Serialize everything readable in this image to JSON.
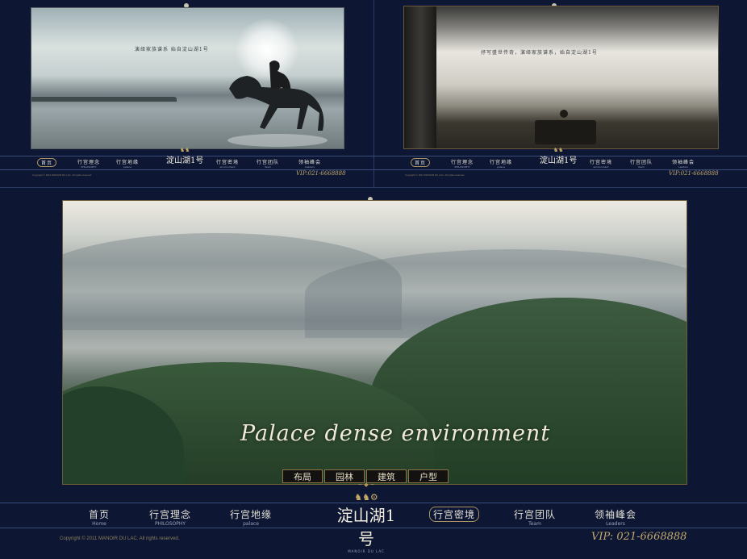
{
  "top_left": {
    "slogan": "演绎家族谱系  始自淀山湖1号",
    "nav": [
      {
        "cn": "首页",
        "en": "Home",
        "active": true
      },
      {
        "cn": "行宫理念",
        "en": "PHILOSOPHY"
      },
      {
        "cn": "行宫地缘",
        "en": "palace"
      },
      {
        "cn": "行宫密境",
        "en": "environment"
      },
      {
        "cn": "行宫团队",
        "en": "Team"
      },
      {
        "cn": "领袖峰会",
        "en": "Leaders"
      }
    ],
    "logo": "淀山湖1号",
    "vip": "VIP:021-6668888",
    "copyright": "Copyright © 2011 MANOIR DU LAC. All rights reserved"
  },
  "top_right": {
    "slogan": "抒写盛世传奇，演绎家族谱系，始自淀山湖1号",
    "nav": [
      {
        "cn": "首页",
        "en": "Home",
        "active": true
      },
      {
        "cn": "行宫理念",
        "en": "PHILOSOPHY"
      },
      {
        "cn": "行宫地缘",
        "en": "palace"
      },
      {
        "cn": "行宫密境",
        "en": "environment"
      },
      {
        "cn": "行宫团队",
        "en": "Team"
      },
      {
        "cn": "领袖峰会",
        "en": "Leaders"
      }
    ],
    "logo": "淀山湖1号",
    "vip": "VIP:021-6668888",
    "copyright": "Copyright © 2011 MANOIR DU LAC. All rights reserved"
  },
  "main": {
    "title": "Palace dense environment",
    "tabs": [
      "布局",
      "园林",
      "建筑",
      "户型"
    ]
  },
  "bottom_nav": {
    "items": [
      {
        "cn": "首页",
        "en": "Home"
      },
      {
        "cn": "行宫理念",
        "en": "PHILOSOPHY"
      },
      {
        "cn": "行宫地缘",
        "en": "palace"
      },
      {
        "cn": "行宫密境",
        "en": "",
        "active": true
      },
      {
        "cn": "行宫团队",
        "en": "Team"
      },
      {
        "cn": "领袖峰会",
        "en": "Leaders"
      }
    ],
    "logo": "淀山湖1号",
    "logo_sub": "MANOIR DU LAC",
    "vip": "VIP: 021-6668888",
    "copyright": "Copyright © 2011 MANOIR DU LAC. All rights reserved."
  },
  "colors": {
    "background": "#0d1633",
    "gold": "#c3aa6e",
    "text": "#e3e0d6"
  }
}
